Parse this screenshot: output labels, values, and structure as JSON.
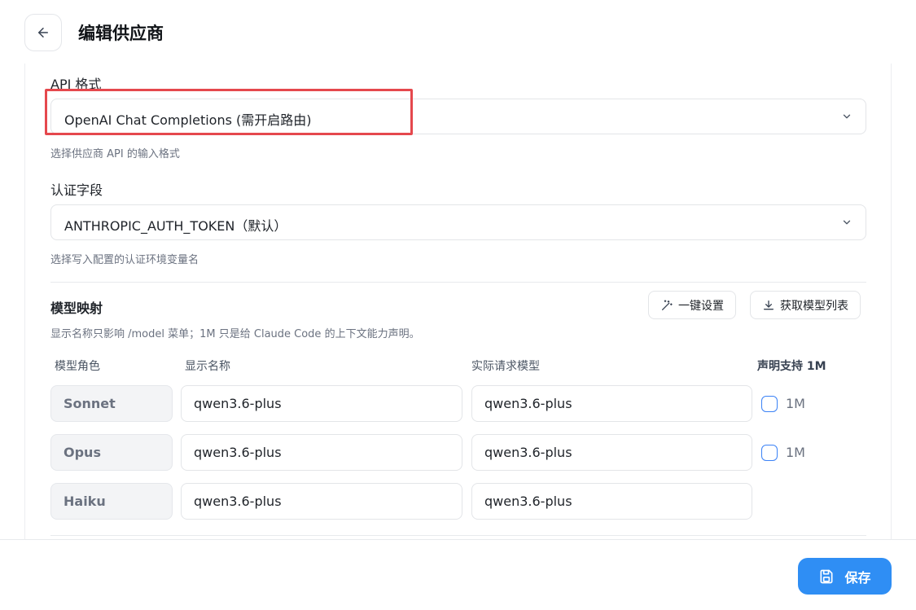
{
  "header": {
    "title": "编辑供应商"
  },
  "api_format": {
    "label": "API 格式",
    "value": "OpenAI Chat Completions (需开启路由)",
    "hint": "选择供应商 API 的输入格式"
  },
  "auth_field": {
    "label": "认证字段",
    "value": "ANTHROPIC_AUTH_TOKEN（默认）",
    "hint": "选择写入配置的认证环境变量名"
  },
  "model_mapping": {
    "title": "模型映射",
    "one_click_label": "一键设置",
    "fetch_models_label": "获取模型列表",
    "description": "显示名称只影响 /model 菜单；1M 只是给 Claude Code 的上下文能力声明。",
    "columns": {
      "role": "模型角色",
      "display_name": "显示名称",
      "request_model": "实际请求模型",
      "declare_1m": "声明支持 1M"
    },
    "rows": [
      {
        "role": "Sonnet",
        "display_name": "qwen3.6-plus",
        "request_model": "qwen3.6-plus",
        "declare_1m_label": "1M",
        "declare_1m_checked": false
      },
      {
        "role": "Opus",
        "display_name": "qwen3.6-plus",
        "request_model": "qwen3.6-plus",
        "declare_1m_label": "1M",
        "declare_1m_checked": false
      },
      {
        "role": "Haiku",
        "display_name": "qwen3.6-plus",
        "request_model": "qwen3.6-plus"
      }
    ]
  },
  "footer": {
    "save_label": "保存"
  },
  "colors": {
    "accent": "#2f8ef4",
    "highlight": "#e5484d",
    "checkbox_border": "#3b82f6"
  }
}
